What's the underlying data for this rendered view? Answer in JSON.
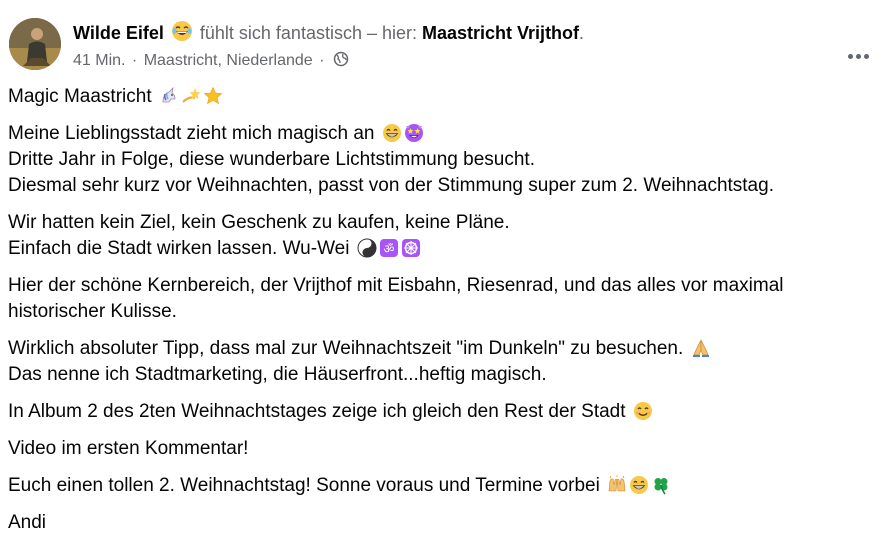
{
  "post": {
    "author": "Wilde Eifel",
    "feeling_text": "fühlt sich fantastisch – hier:",
    "place": "Maastricht Vrijthof",
    "place_suffix": ".",
    "time": "41 Min.",
    "location": "Maastricht, Niederlande",
    "separator": "·",
    "privacy_icon": "globe-icon",
    "feeling_icon": "laughing-face-icon",
    "more_icon": "more-horizontal-icon"
  },
  "content": {
    "p1": {
      "l1": "Magic Maastricht"
    },
    "p2": {
      "l1": "Meine Lieblingsstadt zieht mich magisch an",
      "l2": "Dritte Jahr in Folge, diese wunderbare Lichtstimmung besucht.",
      "l3": "Diesmal sehr kurz vor Weihnachten, passt von der Stimmung super zum 2. Weihnachtstag."
    },
    "p3": {
      "l1": "Wir hatten kein Ziel, kein Geschenk zu kaufen, keine Pläne.",
      "l2": "Einfach die Stadt wirken lassen. Wu-Wei"
    },
    "p4": {
      "l1": "Hier der schöne Kernbereich, der Vrijthof mit Eisbahn, Riesenrad, und das alles vor maximal",
      "l2": "historischer Kulisse."
    },
    "p5": {
      "l1": "Wirklich absoluter Tipp, dass mal zur Weihnachtszeit \"im Dunkeln\" zu besuchen.",
      "l2": "Das nenne ich Stadtmarketing, die Häuserfront...heftig magisch."
    },
    "p6": {
      "l1": "In Album 2 des 2ten Weihnachtstages zeige ich gleich den Rest der Stadt"
    },
    "p7": {
      "l1": "Video im ersten Kommentar!"
    },
    "p8": {
      "l1": "Euch einen tollen 2. Weihnachtstag! Sonne voraus und Termine vorbei"
    },
    "p9": {
      "l1": "Andi"
    }
  },
  "colors": {
    "text": "#050505",
    "secondary_text": "#65676b",
    "background": "#ffffff"
  }
}
